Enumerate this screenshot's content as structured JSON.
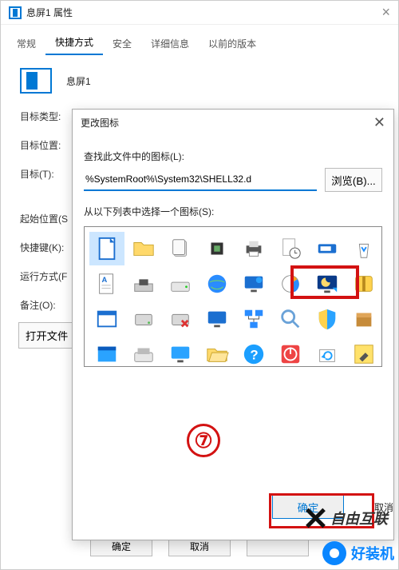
{
  "props": {
    "title": "息屏1 属性",
    "tabs": [
      "常规",
      "快捷方式",
      "安全",
      "详细信息",
      "以前的版本"
    ],
    "active_tab_index": 1,
    "name": "息屏1",
    "labels": {
      "target_type": "目标类型:",
      "target_loc": "目标位置:",
      "target": "目标(T):",
      "start_in": "起始位置(S",
      "hotkey": "快捷键(K):",
      "run_mode": "运行方式(F",
      "comment": "备注(O):"
    },
    "open_file": "打开文件",
    "ok": "确定",
    "cancel": "取消"
  },
  "dialog": {
    "title": "更改图标",
    "find_label": "查找此文件中的图标(L):",
    "path": "%SystemRoot%\\System32\\SHELL32.d",
    "browse": "浏览(B)...",
    "select_label": "从以下列表中选择一个图标(S):",
    "ok": "确定",
    "cancel": "取消"
  },
  "annotations": {
    "step": "⑦"
  },
  "watermarks": {
    "brand1": "自由互联",
    "brand2": "好装机"
  },
  "icons": [
    {
      "id": "doc-blank",
      "sel": true
    },
    {
      "id": "folder"
    },
    {
      "id": "page-stack"
    },
    {
      "id": "chip"
    },
    {
      "id": "printer"
    },
    {
      "id": "clock-doc"
    },
    {
      "id": "run"
    },
    {
      "id": "recycle"
    },
    {
      "id": "text-doc"
    },
    {
      "id": "disk"
    },
    {
      "id": "drive"
    },
    {
      "id": "globe"
    },
    {
      "id": "monitor-net"
    },
    {
      "id": "chart"
    },
    {
      "id": "moon-monitor"
    },
    {
      "id": "zip"
    },
    {
      "id": "window"
    },
    {
      "id": "hdd"
    },
    {
      "id": "hdd-x"
    },
    {
      "id": "monitor"
    },
    {
      "id": "network"
    },
    {
      "id": "search"
    },
    {
      "id": "shield"
    },
    {
      "id": "box"
    },
    {
      "id": "window2"
    },
    {
      "id": "drive2"
    },
    {
      "id": "monitor2"
    },
    {
      "id": "folder-open"
    },
    {
      "id": "help"
    },
    {
      "id": "power"
    },
    {
      "id": "refresh"
    },
    {
      "id": "tool"
    }
  ]
}
